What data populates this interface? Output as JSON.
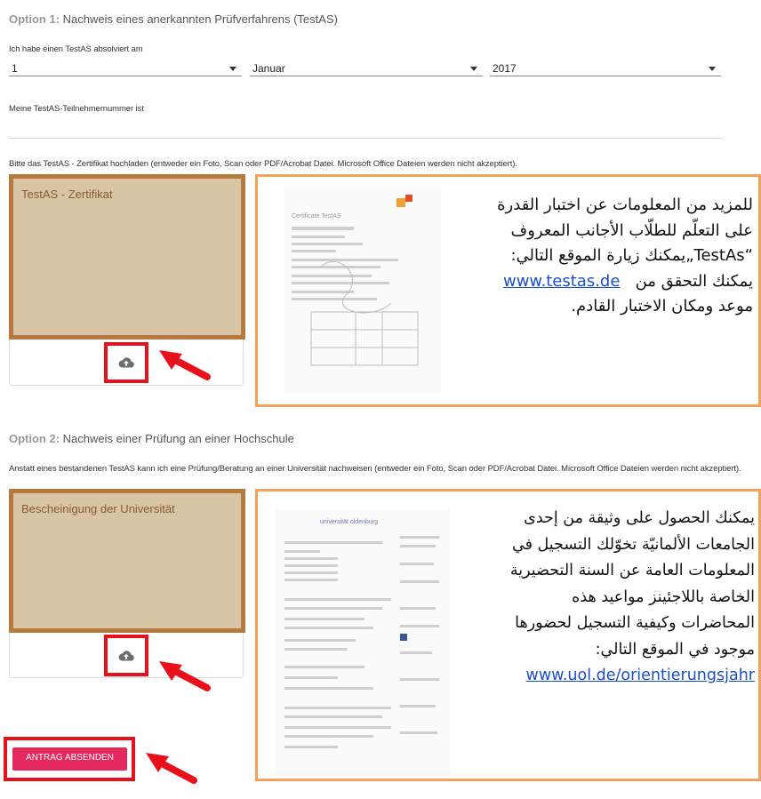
{
  "option1": {
    "prefix": "Option 1:",
    "title": "Nachweis eines anerkannten Prüfverfahrens (TestAS)",
    "date_label": "Ich habe einen TestAS absolviert am",
    "day": "1",
    "month": "Januar",
    "year": "2017",
    "number_label": "Meine TestAS-Teilnehmernummer ist",
    "upload_hint": "Bitte das TestAS - Zertifikat hochladen (entweder ein Foto, Scan oder PDF/Acrobat Datei. Microsoft Office Dateien werden nicht akzeptiert).",
    "upload_box_label": "TestAS - Zertifikat"
  },
  "callout1": {
    "line1": "للمزيد من المعلومات عن اختبار القدرة",
    "line2": "على التعلّم للطلّاب الأجانب المعروف",
    "line3": "“TestAs„يمكنك زيارة الموقع التالي:",
    "link": "www.testas.de",
    "line4_after_link": "يمكنك التحقق من",
    "line5": "موعد ومكان الاختبار القادم."
  },
  "option2": {
    "prefix": "Option 2:",
    "title": "Nachweis einer Prüfung an einer Hochschule",
    "upload_hint": "Anstatt eines bestandenen TestAS kann ich eine Prüfung/Beratung an einer Universität nachweisen (entweder ein Foto, Scan oder PDF/Acrobat Datei. Microsoft Office Dateien werden nicht akzeptiert).",
    "upload_box_label": "Bescheinigung der Universität"
  },
  "callout2": {
    "line1": "يمكنك الحصول على وثيقة من إحدى",
    "line2": "الجامعات الألمانيّة تخوّلك التسجيل في",
    "line3": "المعلومات العامة عن السنة التحضيرية",
    "line4": "الخاصة باللاجئينز مواعيد هذه",
    "line5": "المحاضرات وكيفية التسجيل لحضورها",
    "line6": "موجود في الموقع التالي:",
    "link": "www.uol.de/orientierungsjahr"
  },
  "submit_label": "ANTRAG ABSENDEN",
  "colors": {
    "accent_pink": "#e5285d",
    "highlight_red": "#e8111b",
    "callout_orange": "#f4a259",
    "upload_tan": "#d8c5a6",
    "upload_border": "#b57a3d"
  },
  "icons": [
    "cloud-upload-icon",
    "red-arrow-icon"
  ]
}
